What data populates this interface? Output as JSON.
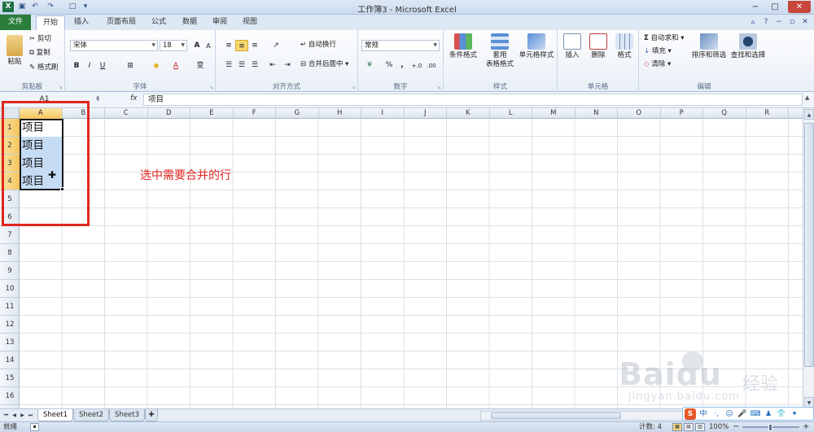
{
  "titlebar": {
    "title": "工作簿3 - Microsoft Excel",
    "logo": "X",
    "qat_icons": [
      "save-icon",
      "undo-icon",
      "redo-icon",
      "new-icon",
      "customize-icon"
    ]
  },
  "ribbon_tabs": {
    "file": "文件",
    "items": [
      {
        "label": "开始"
      },
      {
        "label": "插入"
      },
      {
        "label": "页面布局"
      },
      {
        "label": "公式"
      },
      {
        "label": "数据"
      },
      {
        "label": "审阅"
      },
      {
        "label": "视图"
      }
    ]
  },
  "clipboard": {
    "paste": "粘贴",
    "cut": "剪切",
    "copy": "复制",
    "format_painter": "格式刷",
    "label": "剪贴板"
  },
  "font": {
    "name": "宋体",
    "size": "18",
    "grow": "A",
    "shrink": "A",
    "bold": "B",
    "italic": "I",
    "underline": "U",
    "color_a": "A",
    "phonetic": "变",
    "label": "字体"
  },
  "alignment": {
    "wrap": "自动换行",
    "merge": "合并后居中",
    "label": "对齐方式"
  },
  "number": {
    "format": "常规",
    "percent": "%",
    "comma": ",",
    "inc": "+.0",
    "dec": ".00",
    "label": "数字"
  },
  "styles": {
    "cond": "条件格式",
    "table1": "套用",
    "table2": "表格格式",
    "cell": "单元格样式",
    "label": "样式"
  },
  "cells": {
    "insert": "插入",
    "delete": "删除",
    "format": "格式",
    "label": "单元格"
  },
  "editing": {
    "autosum": "自动求和",
    "fill": "填充",
    "clear": "清除",
    "sort": "排序和筛选",
    "find": "查找和选择",
    "label": "编辑"
  },
  "formula_bar": {
    "name_box": "A1",
    "fx": "fx",
    "value": "项目"
  },
  "columns": [
    "A",
    "B",
    "C",
    "D",
    "E",
    "F",
    "G",
    "H",
    "I",
    "J",
    "K",
    "L",
    "M",
    "N",
    "O",
    "P",
    "Q",
    "R"
  ],
  "rows": [
    "1",
    "2",
    "3",
    "4",
    "5",
    "6",
    "7",
    "8",
    "9",
    "10",
    "11",
    "12",
    "13",
    "14",
    "15",
    "16"
  ],
  "cells_data": [
    "项目",
    "项目",
    "项目",
    "项目"
  ],
  "annotation": "选中需要合并的行",
  "sheets": [
    {
      "name": "Sheet1"
    },
    {
      "name": "Sheet2"
    },
    {
      "name": "Sheet3"
    }
  ],
  "status": {
    "ready": "就绪",
    "count": "计数: 4",
    "zoom": "100%"
  },
  "ime": {
    "label": "中"
  },
  "watermark": {
    "text": "Baidu",
    "jy": "经验",
    "url": "jingyan.baidu.com"
  },
  "colors": {
    "accent_red": "#e0261f",
    "selection_blue": "#c6dcf5",
    "file_tab_green": "#2a7d3b",
    "header_highlight": "#f5c45c"
  }
}
